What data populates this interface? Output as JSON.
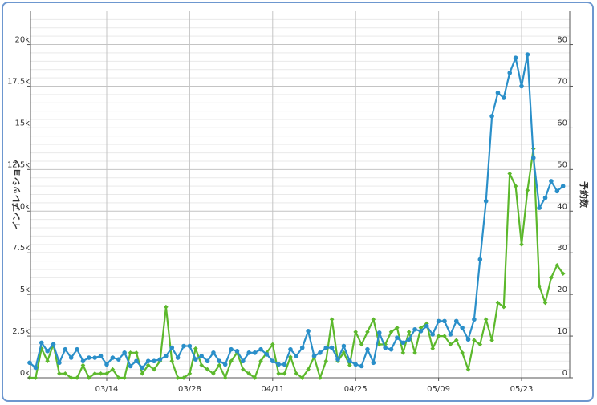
{
  "chart_data": {
    "type": "line",
    "title": "",
    "xlabel": "",
    "ylabel": "インプレッション",
    "y2label": "予約数",
    "ylim": [
      0,
      22000
    ],
    "y2lim": [
      0,
      88
    ],
    "x_ticks": [
      "03/14",
      "03/28",
      "04/11",
      "04/25",
      "05/09",
      "05/23"
    ],
    "y_ticks": [
      "0k",
      "2.5k",
      "5k",
      "7.5k",
      "10k",
      "12.5k",
      "15k",
      "17.5k",
      "20k"
    ],
    "y2_ticks": [
      "0",
      "10",
      "20",
      "30",
      "40",
      "50",
      "60",
      "70",
      "80"
    ],
    "grid": true,
    "colors": {
      "impressions": "#2a8fc9",
      "bookings": "#5cb82c"
    },
    "series": [
      {
        "name": "",
        "axis": "left",
        "values": [
          900,
          600,
          2100,
          1600,
          2000,
          900,
          1700,
          1200,
          1700,
          1000,
          1200,
          1200,
          1300,
          800,
          1200,
          1100,
          1500,
          700,
          1000,
          600,
          1000,
          1000,
          1100,
          1300,
          1800,
          1200,
          1900,
          1900,
          1100,
          1300,
          1000,
          1500,
          1000,
          800,
          1700,
          1600,
          1000,
          1500,
          1500,
          1700,
          1400,
          1000,
          800,
          800,
          1700,
          1300,
          1800,
          2800,
          1300,
          1500,
          1800,
          1800,
          1100,
          1900,
          1000,
          800,
          700,
          1700,
          900,
          2700,
          1800,
          1700,
          2400,
          2100,
          2300,
          2900,
          2800,
          3100,
          2600,
          3400,
          3400,
          2600,
          3400,
          3000,
          2300,
          3500,
          7100,
          10600,
          15700,
          17100,
          16800,
          18300,
          19200,
          17500,
          19400,
          13200,
          10200,
          10800,
          11800,
          11200,
          11500
        ]
      },
      {
        "name": "",
        "axis": "right",
        "values": [
          0,
          0,
          7,
          4,
          8,
          1,
          1,
          0,
          0,
          3,
          0,
          1,
          1,
          1,
          2,
          0,
          0,
          6,
          6,
          1,
          3,
          2,
          4,
          17,
          4,
          0,
          0,
          1,
          7,
          3,
          2,
          1,
          3,
          0,
          4,
          6,
          2,
          1,
          0,
          4,
          6,
          8,
          1,
          1,
          5,
          1,
          0,
          2,
          5,
          0,
          4,
          14,
          4,
          6,
          3,
          11,
          8,
          11,
          14,
          8,
          8,
          11,
          12,
          6,
          11,
          6,
          12,
          13,
          7,
          10,
          10,
          8,
          9,
          6,
          2,
          9,
          8,
          14,
          9,
          18,
          17,
          49,
          46,
          32,
          45,
          55,
          22,
          18,
          24,
          27,
          25
        ]
      }
    ]
  }
}
